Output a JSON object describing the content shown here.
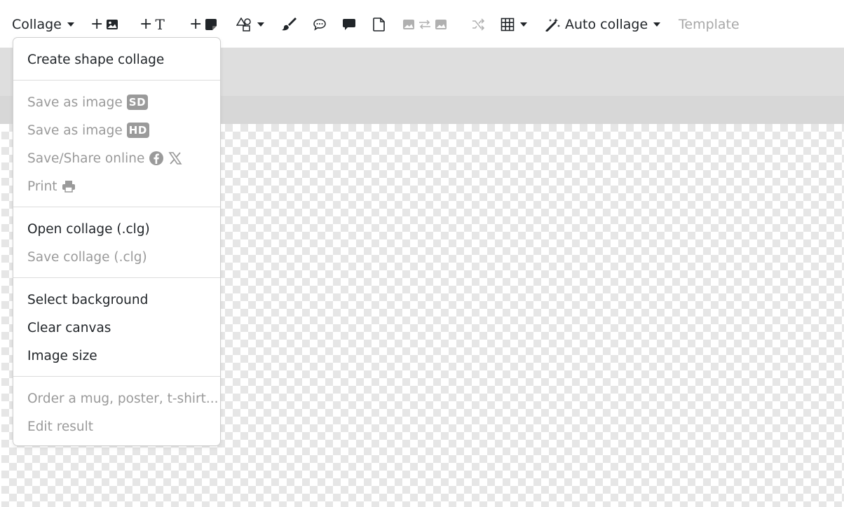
{
  "toolbar": {
    "collage_label": "Collage",
    "auto_collage_label": "Auto collage",
    "template_label": "Template",
    "add_image_plus": "+",
    "add_text_plus": "+",
    "add_sticker_plus": "+",
    "text_glyph": "T"
  },
  "menu": {
    "items": [
      {
        "label": "Create shape collage"
      },
      {
        "label": "Save as image",
        "badge": "SD"
      },
      {
        "label": "Save as image",
        "badge": "HD"
      },
      {
        "label": "Save/Share online"
      },
      {
        "label": "Print"
      },
      {
        "label": "Open collage (.clg)"
      },
      {
        "label": "Save collage (.clg)"
      },
      {
        "label": "Select background"
      },
      {
        "label": "Clear canvas"
      },
      {
        "label": "Image size"
      },
      {
        "label": "Order a mug, poster, t-shirt..."
      },
      {
        "label": "Edit result"
      }
    ]
  },
  "colors": {
    "text": "#212529",
    "disabled": "#9a9a9a",
    "canvas_gray": "#dedede",
    "checker": "#e6e6e6"
  },
  "icons": [
    "image-icon",
    "shapes-icon",
    "brush-icon",
    "speech-bubble-icon",
    "comment-icon",
    "file-icon",
    "swap-icon",
    "shuffle-icon",
    "grid-icon",
    "magic-wand-icon",
    "facebook-icon",
    "x-icon",
    "printer-icon"
  ]
}
